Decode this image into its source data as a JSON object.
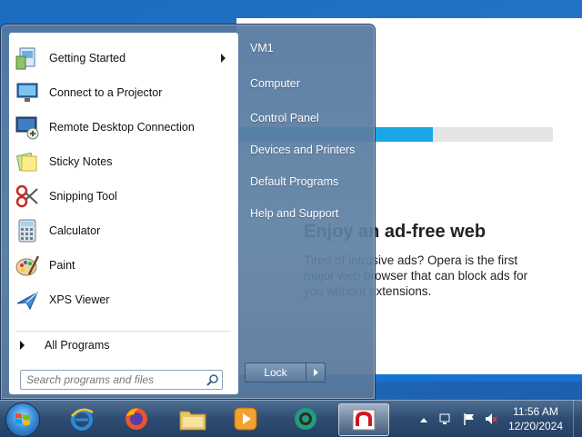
{
  "installer": {
    "headline": "Enjoy an ad-free web",
    "body": "Tired of intrusive ads? Opera is the first major web browser that can block ads for you without extensions.",
    "progress_fraction": 0.62
  },
  "start_menu": {
    "programs": [
      {
        "label": "Getting Started",
        "icon": "getting-started-icon",
        "has_submenu": true
      },
      {
        "label": "Connect to a Projector",
        "icon": "projector-icon"
      },
      {
        "label": "Remote Desktop Connection",
        "icon": "remote-desktop-icon"
      },
      {
        "label": "Sticky Notes",
        "icon": "sticky-notes-icon"
      },
      {
        "label": "Snipping Tool",
        "icon": "snipping-tool-icon"
      },
      {
        "label": "Calculator",
        "icon": "calculator-icon"
      },
      {
        "label": "Paint",
        "icon": "paint-icon"
      },
      {
        "label": "XPS Viewer",
        "icon": "xps-viewer-icon"
      }
    ],
    "all_programs": "All Programs",
    "search_placeholder": "Search programs and files",
    "right_items": [
      "VM1",
      "Computer",
      "Control Panel",
      "Devices and Printers",
      "Default Programs",
      "Help and Support"
    ],
    "lock_label": "Lock"
  },
  "taskbar": {
    "apps": [
      "internet-explorer-icon",
      "firefox-icon",
      "file-explorer-icon",
      "media-player-icon",
      "opera-installer-icon",
      "opera-icon"
    ],
    "clock_time": "11:56 AM",
    "clock_date": "12/20/2024"
  }
}
